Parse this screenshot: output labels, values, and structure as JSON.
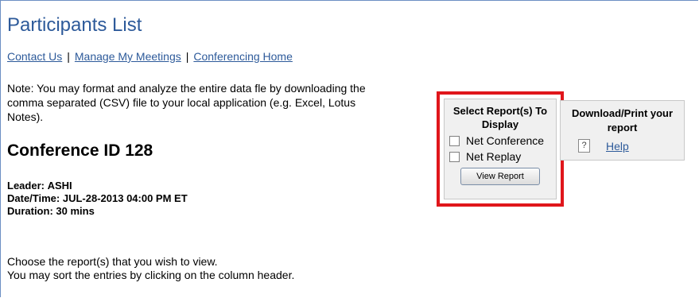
{
  "page": {
    "title": "Participants List"
  },
  "nav": {
    "contact": "Contact Us",
    "separator1": "|",
    "manage": "Manage My Meetings",
    "separator2": "|",
    "home": "Conferencing Home"
  },
  "note": {
    "line1": "Note: You may format and analyze the entire data fle by downloading the",
    "line2": "comma separated (CSV) file to your local application (e.g. Excel, Lotus",
    "line3": "Notes)."
  },
  "conference": {
    "id_label": "Conference ID 128",
    "leader_label": "Leader:",
    "leader_value": "ASHI",
    "datetime_label": "Date/Time:",
    "datetime_value": "JUL-28-2013 04:00 PM ET",
    "duration_label": "Duration:",
    "duration_value": "30 mins"
  },
  "instructions": {
    "line1": "Choose the report(s) that you wish to view.",
    "line2": "You may sort the entries by clicking on the column header."
  },
  "report_panel": {
    "heading_line1": "Select Report(s) To",
    "heading_line2": "Display",
    "option1": "Net Conference",
    "option2": "Net Replay",
    "button": "View Report"
  },
  "download_panel": {
    "heading_line1": "Download/Print your",
    "heading_line2": "report",
    "help_icon_glyph": "?",
    "help": "Help"
  },
  "colors": {
    "title_blue": "#2d5a9a",
    "highlight_red": "#e0161b",
    "panel_bg": "#f0f0f0"
  }
}
